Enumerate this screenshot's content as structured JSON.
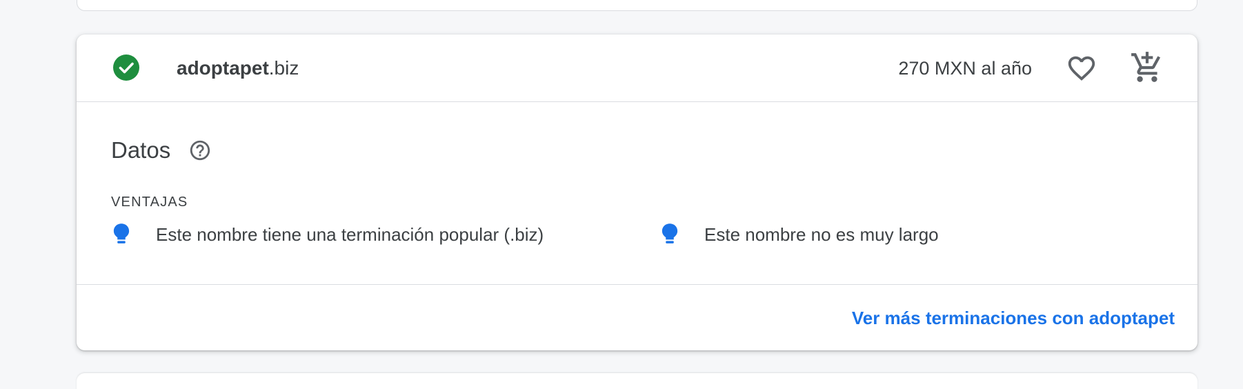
{
  "result": {
    "domain_name": "adoptapet",
    "domain_tld": ".biz",
    "price": "270 MXN al año",
    "status_icon": "check-circle-icon",
    "status_color": "#1e8e3e",
    "favorite_icon": "heart-outline-icon",
    "cart_icon": "add-shopping-cart-icon"
  },
  "details": {
    "title": "Datos",
    "help_icon": "help-circle-icon",
    "benefits_label": "VENTAJAS",
    "benefits": [
      {
        "icon": "lightbulb-icon",
        "text": "Este nombre tiene una terminación popular (.biz)"
      },
      {
        "icon": "lightbulb-icon",
        "text": "Este nombre no es muy largo"
      }
    ],
    "tip_color": "#1a73e8"
  },
  "footer": {
    "more_link": "Ver más terminaciones con adoptapet",
    "link_color": "#1a73e8"
  }
}
